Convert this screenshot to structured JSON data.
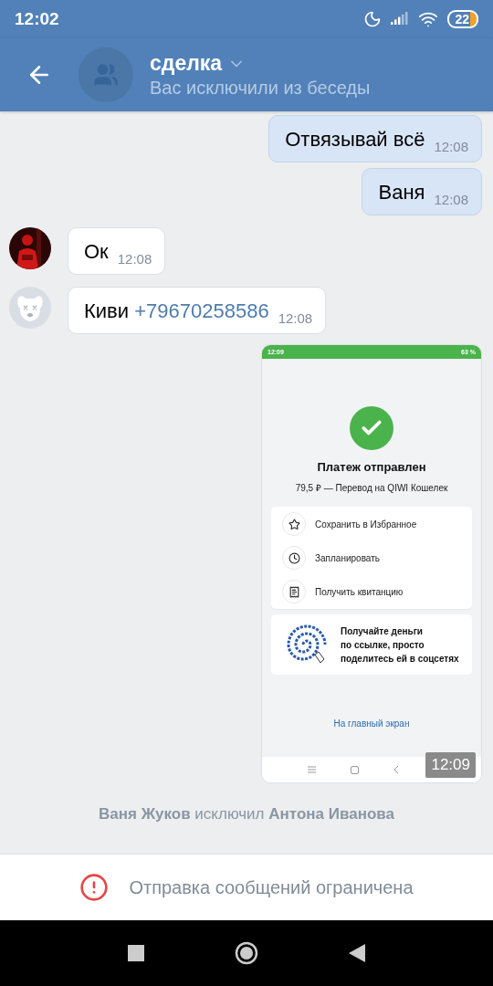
{
  "status_bar": {
    "time": "12:02",
    "battery": "22"
  },
  "header": {
    "title": "сделка",
    "subtitle": "Вас исключили из беседы"
  },
  "messages": [
    {
      "kind": "outgoing",
      "text": "Отвязывай всё",
      "time": "12:08"
    },
    {
      "kind": "outgoing",
      "text": "Ваня",
      "time": "12:08"
    },
    {
      "kind": "incoming",
      "text": "Ок",
      "time": "12:08"
    },
    {
      "kind": "incoming",
      "avatar": {
        "kind": "deleted"
      },
      "text": "Киви",
      "link": "+79670258586",
      "time": "12:08"
    },
    {
      "time": "12:09",
      "screenshot": {
        "status_time": "12:09",
        "battery": "63 %",
        "title": "Платеж отправлен",
        "subtitle": "79,5 ₽ — Перевод на QIWI Кошелек",
        "actions": [
          {
            "label": "Сохранить в Избранное"
          },
          {
            "label": "Запланировать"
          },
          {
            "label": "Получить квитанцию"
          }
        ],
        "promo_lines": [
          "Получайте деньги",
          "по ссылке, просто",
          "поделитесь ей в соцсетях"
        ],
        "home_link": "На главный экран"
      }
    }
  ],
  "service_message": "**Ваня Жуков** исключил **Антона Иванова**",
  "restriction": "Отправка сообщений ограничена"
}
